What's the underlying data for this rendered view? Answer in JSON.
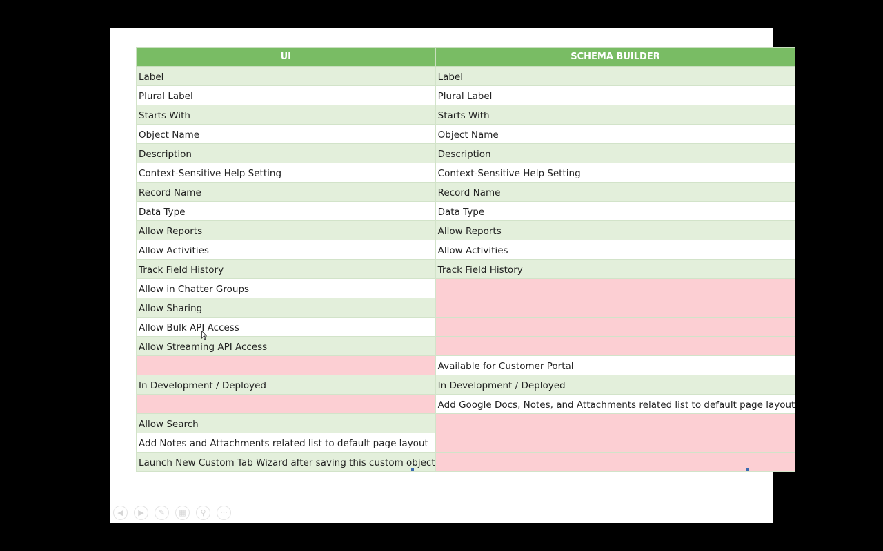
{
  "table": {
    "headers": [
      "UI",
      "SCHEMA BUILDER"
    ],
    "rows": [
      [
        "Label",
        "Label"
      ],
      [
        "Plural Label",
        "Plural Label"
      ],
      [
        "Starts With",
        "Starts With"
      ],
      [
        "Object Name",
        "Object Name"
      ],
      [
        "Description",
        "Description"
      ],
      [
        "Context-Sensitive Help Setting",
        "Context-Sensitive Help Setting"
      ],
      [
        "Record Name",
        "Record Name"
      ],
      [
        "Data Type",
        "Data Type"
      ],
      [
        "Allow Reports",
        "Allow Reports"
      ],
      [
        "Allow Activities",
        "Allow Activities"
      ],
      [
        "Track Field History",
        "Track Field History"
      ],
      [
        "Allow in Chatter Groups",
        ""
      ],
      [
        "Allow Sharing",
        ""
      ],
      [
        "Allow Bulk API Access",
        ""
      ],
      [
        "Allow Streaming API Access",
        ""
      ],
      [
        "",
        "Available for Customer Portal"
      ],
      [
        "In Development  / Deployed",
        "In Development  / Deployed"
      ],
      [
        "",
        "Add Google Docs, Notes, and Attachments related list to default page layout"
      ],
      [
        "Allow Search",
        ""
      ],
      [
        "Add Notes and Attachments related list to default page layout",
        ""
      ],
      [
        "Launch New Custom Tab Wizard after saving this custom object",
        ""
      ]
    ]
  },
  "colors": {
    "header_bg": "#79bc64",
    "row_green": "#e3efdb",
    "row_white": "#ffffff",
    "missing_pink": "#fccfd3"
  },
  "toolbar": {
    "buttons": [
      {
        "name": "previous-slide-button",
        "icon": "arrow-left-icon",
        "glyph": "◀"
      },
      {
        "name": "next-slide-button",
        "icon": "arrow-right-icon",
        "glyph": "▶"
      },
      {
        "name": "pen-button",
        "icon": "pen-icon",
        "glyph": "✎"
      },
      {
        "name": "slides-grid-button",
        "icon": "slides-icon",
        "glyph": "▦"
      },
      {
        "name": "zoom-button",
        "icon": "magnifier-icon",
        "glyph": "⚲"
      },
      {
        "name": "more-options-button",
        "icon": "ellipsis-icon",
        "glyph": "···"
      }
    ]
  }
}
